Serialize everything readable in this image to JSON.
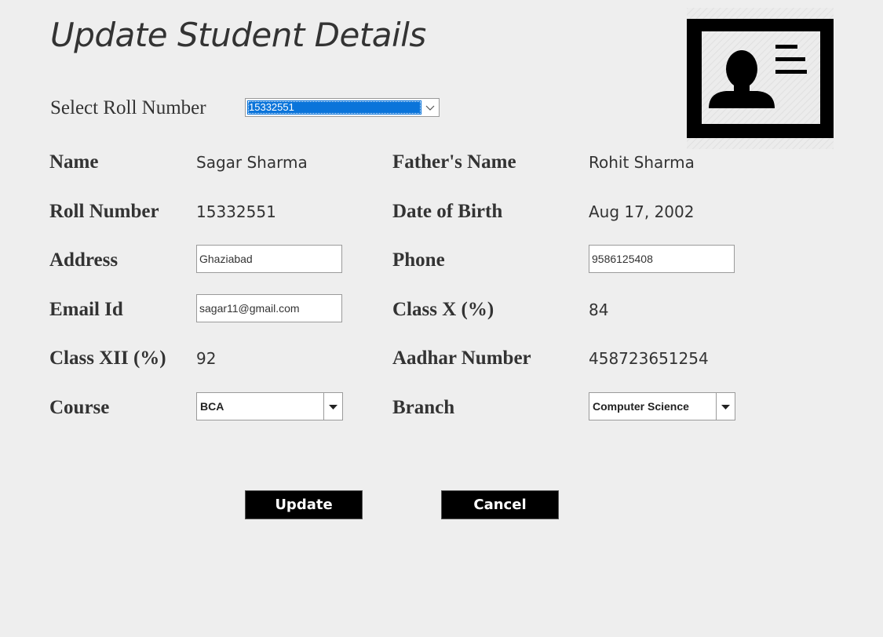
{
  "page": {
    "title": "Update Student Details",
    "background": "#eeeeee"
  },
  "header_icon": {
    "name": "id-card-icon"
  },
  "roll_select": {
    "label": "Select Roll Number",
    "selected": "15332551",
    "highlight_color": "#0a74da"
  },
  "fields": {
    "name": {
      "label": "Name",
      "value": "Sagar Sharma"
    },
    "father_name": {
      "label": "Father's Name",
      "value": "Rohit Sharma"
    },
    "roll_number": {
      "label": "Roll Number",
      "value": "15332551"
    },
    "dob": {
      "label": "Date of Birth",
      "value": "Aug 17, 2002"
    },
    "address": {
      "label": "Address",
      "value": "Ghaziabad"
    },
    "phone": {
      "label": "Phone",
      "value": "9586125408"
    },
    "email": {
      "label": "Email Id",
      "value": "sagar11@gmail.com"
    },
    "class_x": {
      "label": "Class X (%)",
      "value": "84"
    },
    "class_xii": {
      "label": "Class XII (%)",
      "value": "92"
    },
    "aadhar": {
      "label": "Aadhar Number",
      "value": "458723651254"
    },
    "course": {
      "label": "Course",
      "value": "BCA"
    },
    "branch": {
      "label": "Branch",
      "value": "Computer Science"
    }
  },
  "buttons": {
    "update": "Update",
    "cancel": "Cancel",
    "background": "#000000",
    "text_color": "#ffffff"
  }
}
